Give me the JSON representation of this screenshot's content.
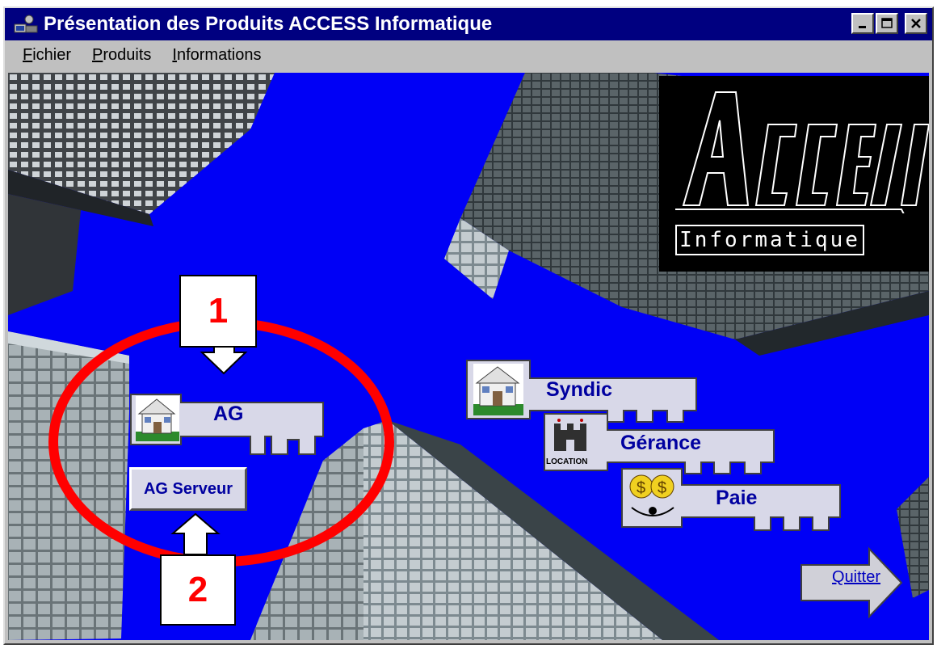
{
  "window": {
    "title": "Présentation des Produits ACCESS Informatique",
    "controls": [
      "minimize",
      "maximize",
      "close"
    ]
  },
  "menu": {
    "items": [
      {
        "label": "Fichier",
        "mnemonic": "F",
        "rest": "ichier"
      },
      {
        "label": "Produits",
        "mnemonic": "P",
        "rest": "roduits"
      },
      {
        "label": "Informations",
        "mnemonic": "I",
        "rest": "nformations"
      }
    ]
  },
  "logo": {
    "wordmark": "ACCESS",
    "text": "Informatique"
  },
  "products": {
    "ag": {
      "label": "AG",
      "icon": "house-icon"
    },
    "ag_serveur": {
      "label": "AG Serveur"
    },
    "syndic": {
      "label": "Syndic",
      "icon": "house-icon"
    },
    "gerance": {
      "label": "Gérance",
      "icon": "castle-icon",
      "icon_caption": "LOCATION"
    },
    "paie": {
      "label": "Paie",
      "icon": "coins-face-icon"
    }
  },
  "quit": {
    "label": "Quitter",
    "mnemonic": "Q",
    "rest": "uitter"
  },
  "annotations": {
    "callout_1": "1",
    "callout_2": "2",
    "highlight_color": "#ff0000"
  },
  "colors": {
    "title_bar": "#000080",
    "sky": "#0000f6",
    "key": "#d8d8e8",
    "key_text": "#0000a0"
  }
}
